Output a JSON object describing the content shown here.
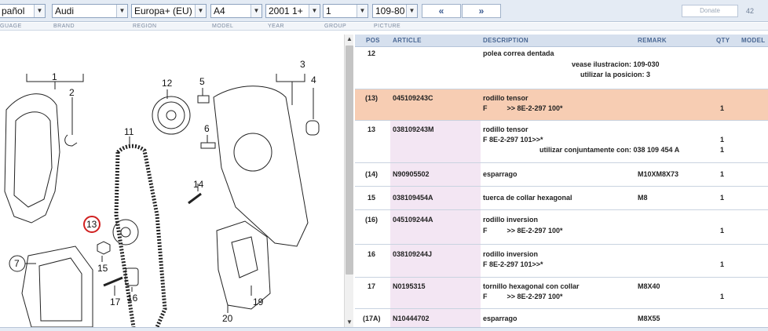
{
  "filters": {
    "language": "pañol",
    "brand": "Audi",
    "region": "Europa+ (EU)",
    "model": "A4",
    "year": "2001  1+",
    "group": "1",
    "picture": "109-80",
    "prev_label": "«",
    "next_label": "»",
    "donate_label": "Donate",
    "page_number": "42"
  },
  "labels": {
    "language": "GUAGE",
    "brand": "BRAND",
    "region": "REGION",
    "model": "MODEL",
    "year": "YEAR",
    "group": "GROUP",
    "picture": "PICTURE"
  },
  "table": {
    "headers": {
      "pos": "POS",
      "article": "ARTICLE",
      "description": "DESCRIPTION",
      "remark": "REMARK",
      "qty": "QTY",
      "model": "MODEL"
    },
    "rows": [
      {
        "pos": "12",
        "article": "",
        "desc1": "polea correa dentada",
        "desc2": "",
        "desc3": "",
        "remark": "vease ilustracion: 109-030",
        "remark2": "utilizar la posicion: 3",
        "qty": "",
        "qty2": ""
      },
      {
        "pos": "(13)",
        "article": "045109243C",
        "desc1": "rodillo tensor",
        "desc2": "F          >> 8E-2-297 100*",
        "desc3": "",
        "remark": "",
        "remark2": "",
        "qty": "",
        "qty2": "1"
      },
      {
        "pos": "13",
        "article": "038109243M",
        "desc1": "rodillo tensor",
        "desc2": "F 8E-2-297 101>>*",
        "desc3": "utilizar conjuntamente con: 038 109 454 A",
        "remark": "",
        "remark2": "",
        "qty": "1",
        "qty2": "1"
      },
      {
        "pos": "(14)",
        "article": "N90905502",
        "desc1": "esparrago",
        "desc2": "",
        "desc3": "",
        "remark": "M10XM8X73",
        "remark2": "",
        "qty": "1",
        "qty2": ""
      },
      {
        "pos": "15",
        "article": "038109454A",
        "desc1": "tuerca de collar hexagonal",
        "desc2": "",
        "desc3": "",
        "remark": "M8",
        "remark2": "",
        "qty": "1",
        "qty2": ""
      },
      {
        "pos": "(16)",
        "article": "045109244A",
        "desc1": "rodillo inversion",
        "desc2": "F          >> 8E-2-297 100*",
        "desc3": "",
        "remark": "",
        "remark2": "",
        "qty": "",
        "qty2": "1"
      },
      {
        "pos": "16",
        "article": "038109244J",
        "desc1": "rodillo inversion",
        "desc2": "F 8E-2-297 101>>*",
        "desc3": "",
        "remark": "",
        "remark2": "",
        "qty": "",
        "qty2": "1"
      },
      {
        "pos": "17",
        "article": "N0195315",
        "desc1": "tornillo hexagonal con collar",
        "desc2": "F          >> 8E-2-297 100*",
        "desc3": "",
        "remark": "M8X40",
        "remark2": "",
        "qty": "",
        "qty2": "1"
      },
      {
        "pos": "(17A)",
        "article": "N10444702",
        "desc1": "esparrago",
        "desc2": "",
        "desc3": "",
        "remark": "M8X55",
        "remark2": "",
        "qty": "",
        "qty2": ""
      }
    ]
  },
  "diagram": {
    "callouts": [
      "1",
      "2",
      "3",
      "4",
      "5",
      "6",
      "7",
      "11",
      "12",
      "13",
      "14",
      "15",
      "16",
      "17",
      "19",
      "20"
    ]
  },
  "colors": {
    "selected_row": "#f7cdb3",
    "article_cell": "#f3e6f3",
    "header": "#d6e0ee",
    "highlight_circle": "#d02020"
  }
}
